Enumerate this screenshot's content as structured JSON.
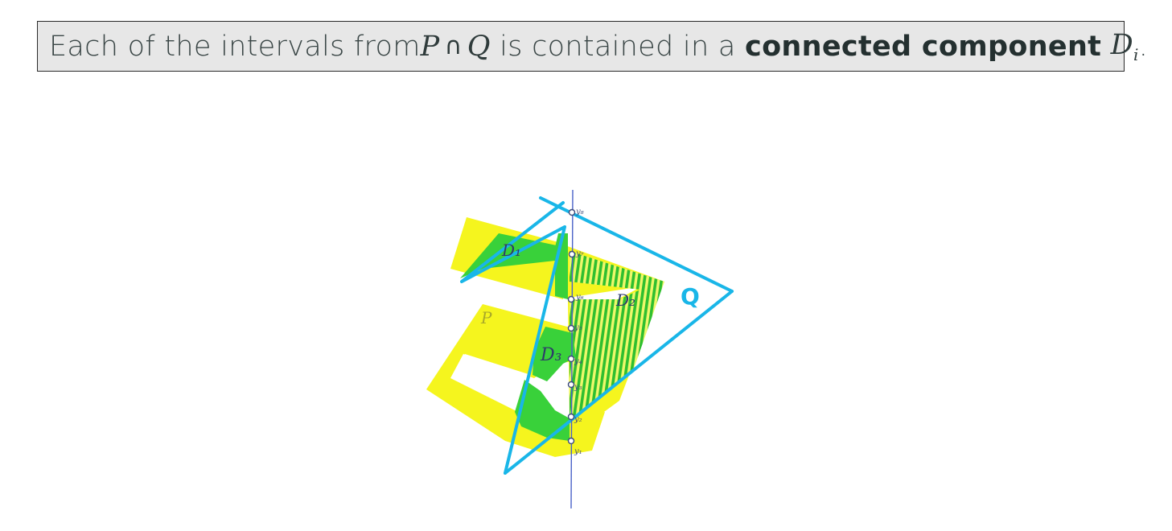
{
  "statement": {
    "prefix": "Each of the intervals from ",
    "set_p": "P",
    "cap_symbol": "∩",
    "set_q": "Q",
    "middle": " is contained in a ",
    "emphasis": "connected component",
    "component_symbol": "D",
    "component_subscript": "i",
    "suffix": "."
  },
  "sketch": {
    "label_P": "P",
    "label_Q": "Q",
    "label_D1": "D₁",
    "label_D2": "D₂",
    "label_D3": "D₃",
    "line_points": [
      {
        "label": "y₁"
      },
      {
        "label": "y₂"
      },
      {
        "label": "y₃"
      },
      {
        "label": "y₄"
      },
      {
        "label": "y₅"
      },
      {
        "label": "y₆"
      },
      {
        "label": "y₇"
      },
      {
        "label": "y₈"
      }
    ],
    "colors": {
      "region_P": "#f5f51e",
      "intersection": "#39d13a",
      "hatch": "#2fbf2f",
      "polygon_Q": "#19b6e8",
      "line": "#4a62c8",
      "ink": "#3c4a7a"
    }
  }
}
